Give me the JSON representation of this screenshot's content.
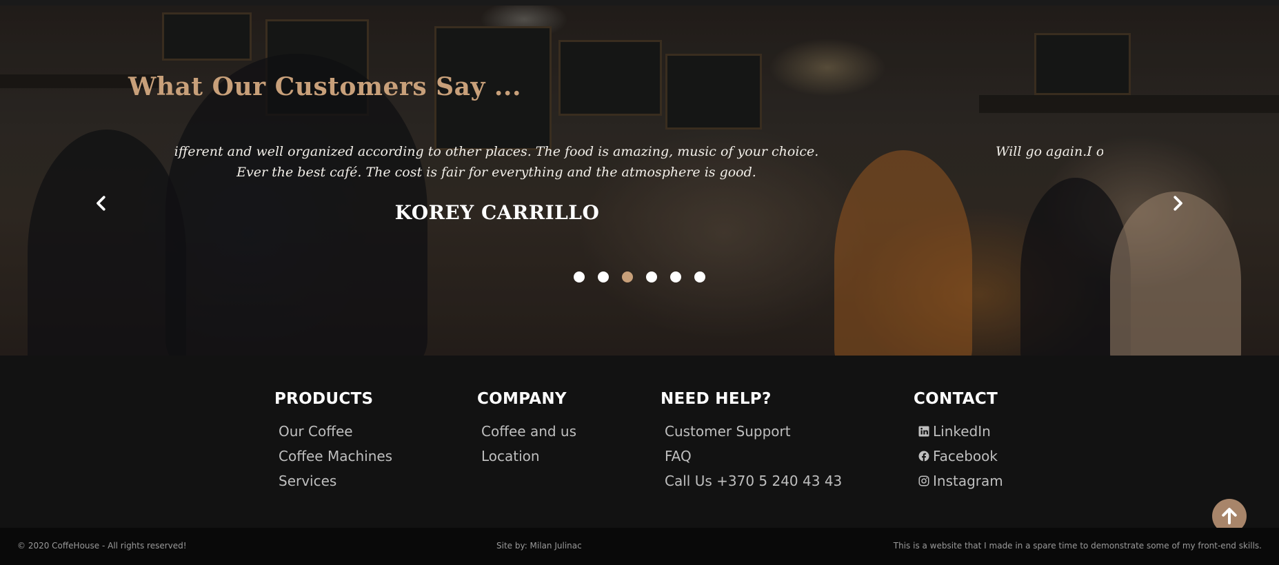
{
  "testimonials": {
    "title": "What Our Customers Say ...",
    "quote_current": "ifferent and well organized according to other places. The food is amazing, music of your choice. Ever the best café. The cost is fair for everything and the atmosphere is good.",
    "quote_next": "Will go again.I o",
    "author": "KOREY CARRILLO",
    "dots_count": 6,
    "active_dot": 3,
    "accent_color": "#c8a07a"
  },
  "footer": {
    "products": {
      "heading": "PRODUCTS",
      "items": [
        "Our Coffee",
        "Coffee Machines",
        "Services"
      ]
    },
    "company": {
      "heading": "COMPANY",
      "items": [
        "Coffee and us",
        "Location"
      ]
    },
    "help": {
      "heading": "NEED HELP?",
      "items": [
        "Customer Support",
        "FAQ",
        "Call Us +370 5 240 43 43"
      ]
    },
    "contact": {
      "heading": "CONTACT",
      "items": [
        {
          "label": "LinkedIn",
          "icon": "linkedin-icon"
        },
        {
          "label": "Facebook",
          "icon": "facebook-icon"
        },
        {
          "label": "Instagram",
          "icon": "instagram-icon"
        }
      ]
    }
  },
  "bottom_bar": {
    "copyright": "© 2020 CoffeHouse - All rights reserved!",
    "credit": "Site by: Milan Julinac",
    "note": "This is a website that I made in a spare time to demonstrate some of my front-end skills."
  }
}
